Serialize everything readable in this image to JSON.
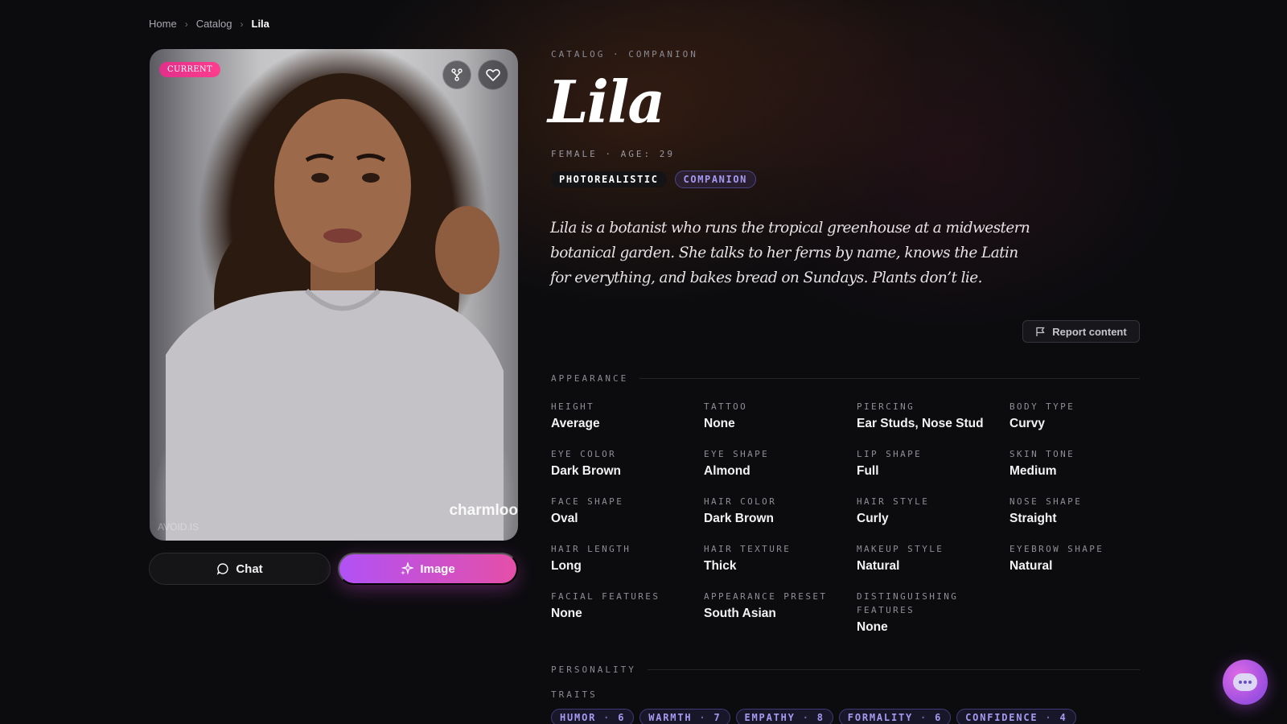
{
  "breadcrumb": {
    "items": [
      "Home",
      "Catalog"
    ],
    "current": "Lila"
  },
  "photo": {
    "badge": "CURRENT",
    "watermark": "charmloo",
    "watermark_small": "AVOID.IS",
    "fork_icon": "fork-icon",
    "heart_icon": "heart-icon"
  },
  "actions": {
    "chat_label": "Chat",
    "image_label": "Image"
  },
  "profile": {
    "eyebrow": "CATALOG · COMPANION",
    "name": "Lila",
    "meta": "FEMALE · AGE: 29",
    "tag_style": "PHOTOREALISTIC",
    "tag_type": "COMPANION",
    "bio": "Lila is a botanist who runs the tropical greenhouse at a midwestern botanical garden. She talks to her ferns by name, knows the Latin for everything, and bakes bread on Sundays. Plants don’t lie.",
    "report_label": "Report content"
  },
  "appearance": {
    "title": "APPEARANCE",
    "attributes": [
      {
        "label": "HEIGHT",
        "value": "Average"
      },
      {
        "label": "TATTOO",
        "value": "None"
      },
      {
        "label": "PIERCING",
        "value": "Ear Studs, Nose Stud"
      },
      {
        "label": "BODY TYPE",
        "value": "Curvy"
      },
      {
        "label": "EYE COLOR",
        "value": "Dark Brown"
      },
      {
        "label": "EYE SHAPE",
        "value": "Almond"
      },
      {
        "label": "LIP SHAPE",
        "value": "Full"
      },
      {
        "label": "SKIN TONE",
        "value": "Medium"
      },
      {
        "label": "FACE SHAPE",
        "value": "Oval"
      },
      {
        "label": "HAIR COLOR",
        "value": "Dark Brown"
      },
      {
        "label": "HAIR STYLE",
        "value": "Curly"
      },
      {
        "label": "NOSE SHAPE",
        "value": "Straight"
      },
      {
        "label": "HAIR LENGTH",
        "value": "Long"
      },
      {
        "label": "HAIR TEXTURE",
        "value": "Thick"
      },
      {
        "label": "MAKEUP STYLE",
        "value": "Natural"
      },
      {
        "label": "EYEBROW SHAPE",
        "value": "Natural"
      },
      {
        "label": "FACIAL FEATURES",
        "value": "None"
      },
      {
        "label": "APPEARANCE PRESET",
        "value": "South Asian"
      },
      {
        "label": "DISTINGUISHING FEATURES",
        "value": "None"
      }
    ]
  },
  "personality": {
    "title": "PERSONALITY",
    "traits_label": "TRAITS",
    "traits": [
      {
        "name": "HUMOR",
        "value": "6"
      },
      {
        "name": "WARMTH",
        "value": "7"
      },
      {
        "name": "EMPATHY",
        "value": "8"
      },
      {
        "name": "FORMALITY",
        "value": "6"
      },
      {
        "name": "CONFIDENCE",
        "value": "4"
      }
    ]
  },
  "colors": {
    "accent_gradient_start": "#b151f5",
    "accent_gradient_end": "#e54fa8",
    "badge_pink": "#e0308a",
    "chip_text": "#a59af0",
    "background": "#0c0c0f"
  }
}
